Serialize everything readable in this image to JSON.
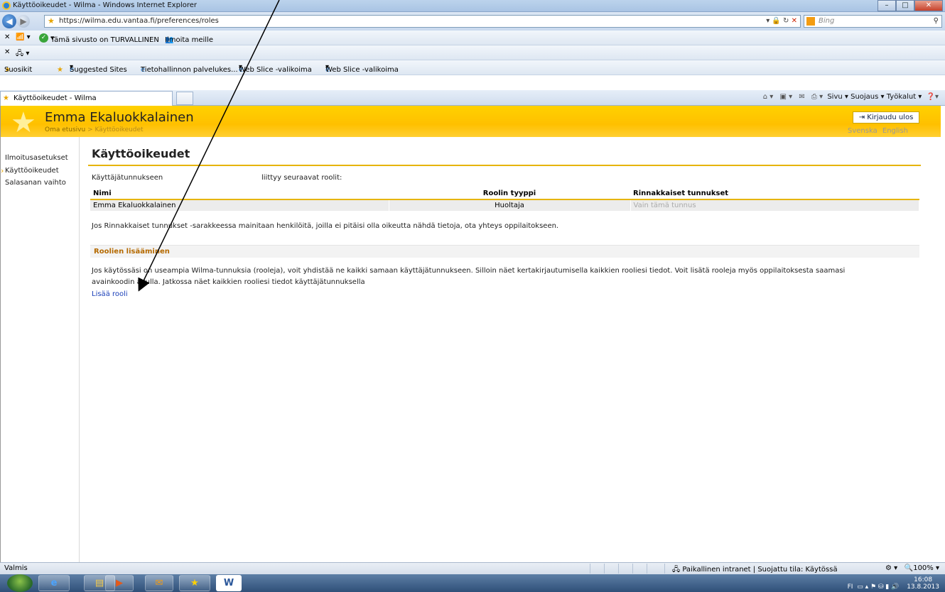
{
  "window": {
    "title": "Käyttöoikeudet - Wilma - Windows Internet Explorer"
  },
  "addressbar": {
    "url": "https://wilma.edu.vantaa.fi/preferences/roles",
    "search_placeholder": "Bing"
  },
  "toolbar1": {
    "safety_text": "Tämä sivusto on TURVALLINEN",
    "report_text": "Ilmoita meille"
  },
  "favorites": {
    "label": "Suosikit",
    "items": [
      "Suggested Sites",
      "Tietohallinnon palvelukes...",
      "Web Slice -valikoima",
      "Web Slice -valikoima"
    ]
  },
  "tab": {
    "label": "Käyttöoikeudet - Wilma"
  },
  "commandbar": {
    "page": "Sivu",
    "safety": "Suojaus",
    "tools": "Työkalut"
  },
  "header": {
    "username": "Emma Ekaluokkalainen",
    "breadcrumb_home": "Oma etusivu",
    "breadcrumb_sep": ">",
    "breadcrumb_current": "Käyttöoikeudet",
    "logout": "Kirjaudu ulos",
    "lang_sv": "Svenska",
    "lang_en": "English"
  },
  "sidebar": {
    "items": [
      {
        "label": "Ilmoitusasetukset"
      },
      {
        "label": "Käyttöoikeudet"
      },
      {
        "label": "Salasanan vaihto"
      }
    ]
  },
  "main": {
    "title": "Käyttöoikeudet",
    "account_label": "Käyttäjätunnukseen",
    "roles_label": "liittyy seuraavat roolit:",
    "table": {
      "headers": [
        "Nimi",
        "Roolin tyyppi",
        "Rinnakkaiset tunnukset"
      ],
      "rows": [
        [
          "Emma Ekaluokkalainen",
          "Huoltaja",
          "Vain tämä tunnus"
        ]
      ]
    },
    "note": "Jos Rinnakkaiset tunnukset -sarakkeessa mainitaan henkilöitä, joilla ei pitäisi olla oikeutta nähdä tietoja, ota yhteys oppilaitokseen.",
    "section_title": "Roolien lisääminen",
    "section_text": "Jos käytössäsi on useampia Wilma-tunnuksia (rooleja), voit yhdistää ne kaikki samaan käyttäjätunnukseen. Silloin näet kertakirjautumisella kaikkien rooliesi tiedot. Voit lisätä rooleja myös oppilaitoksesta saamasi avainkoodin avulla. Jatkossa näet kaikkien rooliesi tiedot käyttäjätunnuksella",
    "add_role_link": "Lisää rooli"
  },
  "statusbar": {
    "left": "Valmis",
    "zone": "Paikallinen intranet | Suojattu tila: Käytössä",
    "zoom": "100%"
  },
  "taskbar": {
    "lang": "FI",
    "time": "16:08",
    "date": "13.8.2013"
  }
}
